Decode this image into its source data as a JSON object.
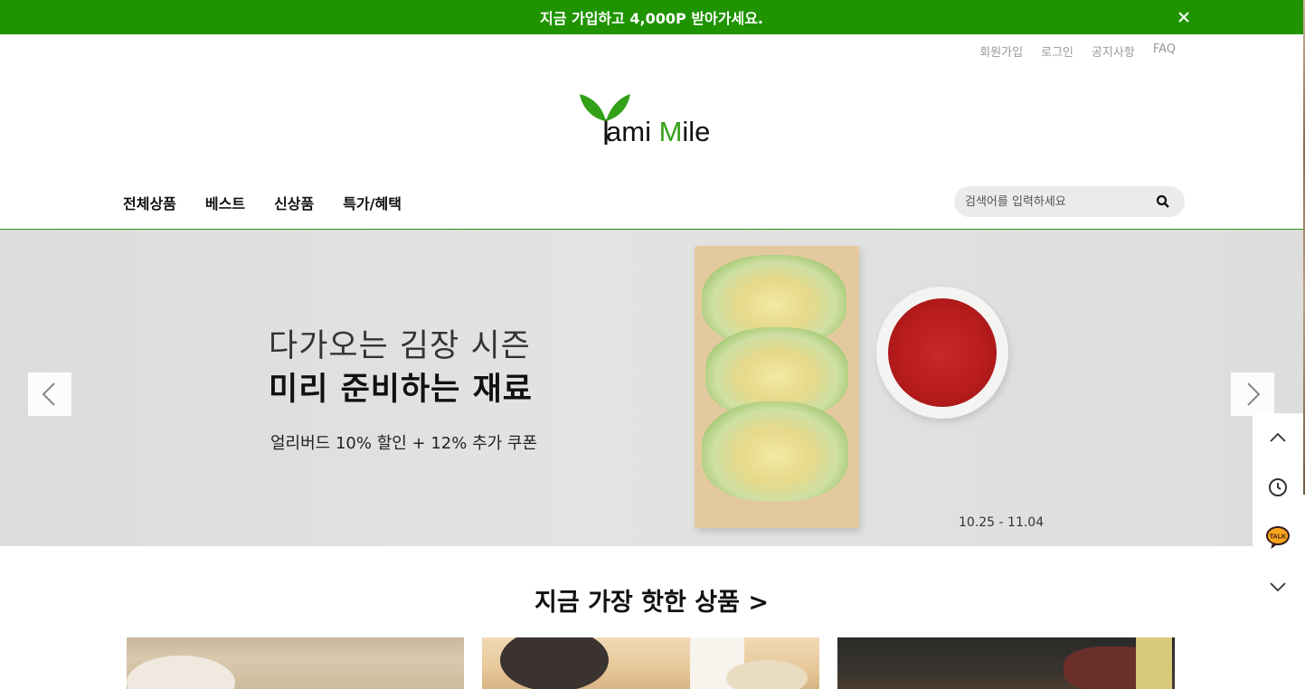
{
  "promo": {
    "text": "지금 가입하고 4,000P 받아가세요.",
    "close_icon": "close-icon"
  },
  "util_links": [
    "회원가입",
    "로그인",
    "공지사항",
    "FAQ"
  ],
  "logo": {
    "text_y": "Y",
    "text_ami": "ami ",
    "text_m": "M",
    "text_ile": "ile",
    "brand_color": "#33a117"
  },
  "gnb": [
    "전체상품",
    "베스트",
    "신상품",
    "특가/혜택"
  ],
  "search": {
    "placeholder": "검색어를 입력하세요",
    "value": ""
  },
  "hero": {
    "line1": "다가오는 김장 시즌",
    "line2": "미리 준비하는 재료",
    "sub": "얼리버드 10% 할인 + 12% 추가 쿠폰",
    "date": "10.25 - 11.04"
  },
  "quick_menu": [
    "chevron-up-icon",
    "clock-icon",
    "kakao-talk-icon",
    "chevron-down-icon"
  ],
  "section": {
    "title": "지금 가장 핫한 상품 >"
  },
  "colors": {
    "accent": "#1f9400",
    "promo_bg": "#1f9400"
  }
}
